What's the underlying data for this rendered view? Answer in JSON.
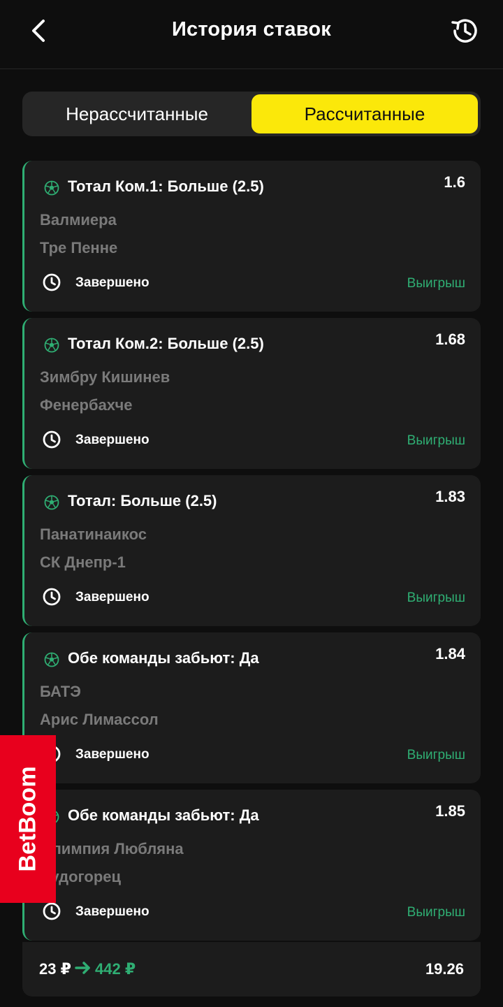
{
  "header": {
    "title": "История ставок"
  },
  "tabs": [
    {
      "label": "Нерассчитанные",
      "active": false
    },
    {
      "label": "Рассчитанные",
      "active": true
    }
  ],
  "bets": [
    {
      "market": "Тотал Ком.1: Больше (2.5)",
      "odds": "1.6",
      "team1": "Валмиера",
      "team2": "Тре Пенне",
      "status": "Завершено",
      "result": "Выигрыш"
    },
    {
      "market": "Тотал Ком.2: Больше (2.5)",
      "odds": "1.68",
      "team1": "Зимбру Кишинев",
      "team2": "Фенербахче",
      "status": "Завершено",
      "result": "Выигрыш"
    },
    {
      "market": "Тотал: Больше (2.5)",
      "odds": "1.83",
      "team1": "Панатинаикос",
      "team2": "СК Днепр-1",
      "status": "Завершено",
      "result": "Выигрыш"
    },
    {
      "market": "Обе команды забьют: Да",
      "odds": "1.84",
      "team1": "БАТЭ",
      "team2": "Арис Лимассол",
      "status": "Завершено",
      "result": "Выигрыш"
    },
    {
      "market": "Обе команды забьют: Да",
      "odds": "1.85",
      "team1": "Олимпия Любляна",
      "team2": "Лудогорец",
      "status": "Завершено",
      "result": "Выигрыш"
    }
  ],
  "summary": {
    "stake": "23 ₽",
    "payout": "442 ₽",
    "total_odds": "19.26"
  },
  "brand": {
    "name": "BetBoom"
  },
  "colors": {
    "accent": "#fbe80a",
    "win": "#2fae73",
    "background": "#0e0e0e",
    "card": "#1c1c1c",
    "brand": "#e8001d"
  }
}
